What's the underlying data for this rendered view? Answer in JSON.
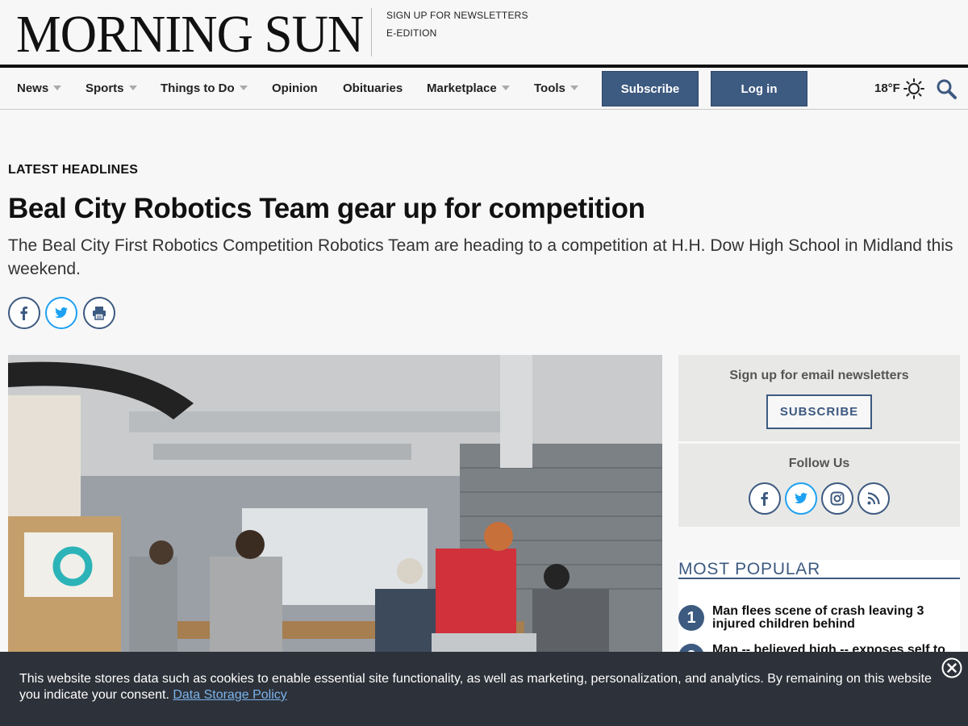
{
  "masthead": {
    "logo_text": "Morning Sun",
    "links": [
      "SIGN UP FOR NEWSLETTERS",
      "E-EDITION"
    ]
  },
  "nav": {
    "items": [
      {
        "label": "News",
        "has_dropdown": true
      },
      {
        "label": "Sports",
        "has_dropdown": true
      },
      {
        "label": "Things to Do",
        "has_dropdown": true
      },
      {
        "label": "Opinion",
        "has_dropdown": false
      },
      {
        "label": "Obituaries",
        "has_dropdown": false
      },
      {
        "label": "Marketplace",
        "has_dropdown": true
      },
      {
        "label": "Tools",
        "has_dropdown": true
      }
    ],
    "subscribe_label": "Subscribe",
    "login_label": "Log in",
    "temperature": "18°F",
    "weather_icon": "sun-icon",
    "search_icon": "search-icon"
  },
  "article": {
    "kicker": "LATEST HEADLINES",
    "headline": "Beal City Robotics Team gear up for competition",
    "dek": "The Beal City First Robotics Competition Robotics Team are heading to a competition at H.H. Dow High School in Midland this weekend.",
    "share_icons": [
      "facebook-icon",
      "twitter-icon",
      "print-icon"
    ]
  },
  "sidebar": {
    "newsletter": {
      "title": "Sign up for email newsletters",
      "button_label": "SUBSCRIBE"
    },
    "follow": {
      "title": "Follow Us",
      "icons": [
        "facebook-icon",
        "twitter-icon",
        "instagram-icon",
        "rss-icon"
      ]
    },
    "most_popular": {
      "title": "MOST POPULAR",
      "items": [
        {
          "rank": "1",
          "text": "Man flees scene of crash leaving 3 injured children behind"
        },
        {
          "rank": "2",
          "text": "Man -- believed high -- exposes self to"
        }
      ]
    }
  },
  "cookie_banner": {
    "text": "This website stores data such as cookies to enable essential site functionality, as well as marketing, personalization, and analytics. By remaining on this website you indicate your consent.",
    "link_text": "Data Storage Policy"
  },
  "colors": {
    "accent": "#3d5a80",
    "banner_bg": "#2d3139",
    "link": "#7bb4ee"
  }
}
